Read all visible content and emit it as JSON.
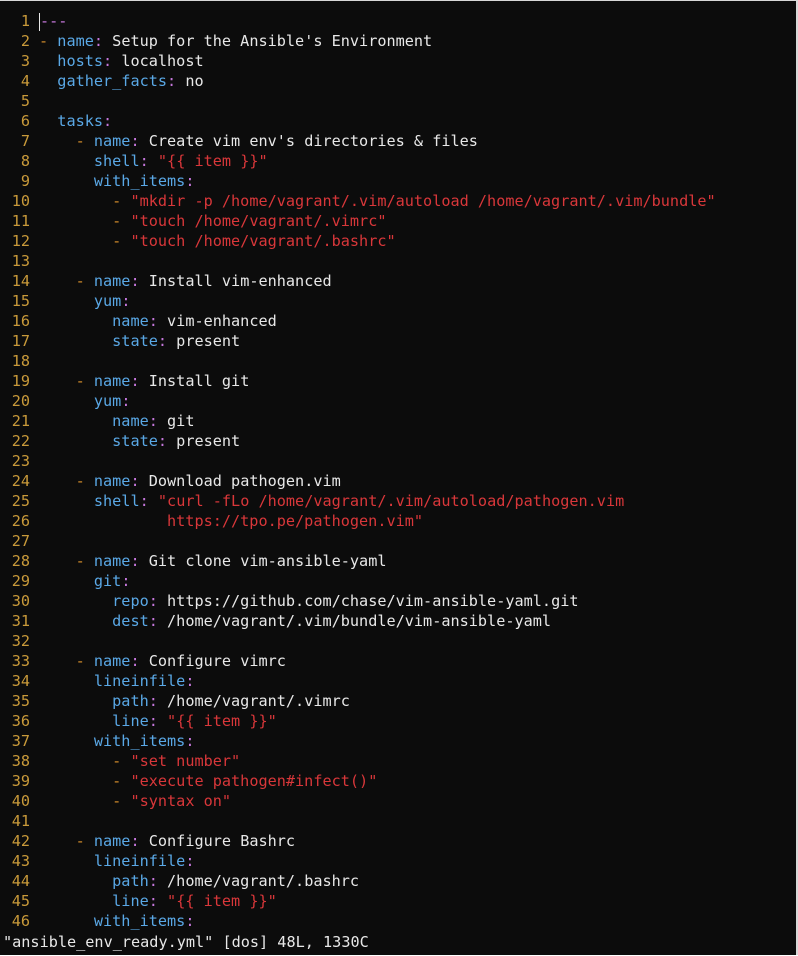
{
  "editor": {
    "lines": [
      {
        "num": "1",
        "tokens": [
          {
            "t": "doc",
            "v": "---"
          }
        ],
        "cursor": true
      },
      {
        "num": "2",
        "tokens": [
          {
            "t": "dash",
            "v": "- "
          },
          {
            "t": "key",
            "v": "name"
          },
          {
            "t": "colon",
            "v": ":"
          },
          {
            "t": "text",
            "v": " Setup for the Ansible's Environment"
          }
        ]
      },
      {
        "num": "3",
        "tokens": [
          {
            "t": "text",
            "v": "  "
          },
          {
            "t": "key",
            "v": "hosts"
          },
          {
            "t": "colon",
            "v": ":"
          },
          {
            "t": "text",
            "v": " localhost"
          }
        ]
      },
      {
        "num": "4",
        "tokens": [
          {
            "t": "text",
            "v": "  "
          },
          {
            "t": "key",
            "v": "gather_facts"
          },
          {
            "t": "colon",
            "v": ":"
          },
          {
            "t": "text",
            "v": " no"
          }
        ]
      },
      {
        "num": "5",
        "tokens": []
      },
      {
        "num": "6",
        "tokens": [
          {
            "t": "text",
            "v": "  "
          },
          {
            "t": "key",
            "v": "tasks"
          },
          {
            "t": "colon",
            "v": ":"
          }
        ]
      },
      {
        "num": "7",
        "tokens": [
          {
            "t": "text",
            "v": "    "
          },
          {
            "t": "dash",
            "v": "- "
          },
          {
            "t": "key",
            "v": "name"
          },
          {
            "t": "colon",
            "v": ":"
          },
          {
            "t": "text",
            "v": " Create vim env's directories & files"
          }
        ]
      },
      {
        "num": "8",
        "tokens": [
          {
            "t": "text",
            "v": "      "
          },
          {
            "t": "key",
            "v": "shell"
          },
          {
            "t": "colon",
            "v": ":"
          },
          {
            "t": "text",
            "v": " "
          },
          {
            "t": "str",
            "v": "\"{{ item }}\""
          }
        ]
      },
      {
        "num": "9",
        "tokens": [
          {
            "t": "text",
            "v": "      "
          },
          {
            "t": "key",
            "v": "with_items"
          },
          {
            "t": "colon",
            "v": ":"
          }
        ]
      },
      {
        "num": "10",
        "tokens": [
          {
            "t": "text",
            "v": "        "
          },
          {
            "t": "dash",
            "v": "- "
          },
          {
            "t": "str",
            "v": "\"mkdir -p /home/vagrant/.vim/autoload /home/vagrant/.vim/bundle\""
          }
        ]
      },
      {
        "num": "11",
        "tokens": [
          {
            "t": "text",
            "v": "        "
          },
          {
            "t": "dash",
            "v": "- "
          },
          {
            "t": "str",
            "v": "\"touch /home/vagrant/.vimrc\""
          }
        ]
      },
      {
        "num": "12",
        "tokens": [
          {
            "t": "text",
            "v": "        "
          },
          {
            "t": "dash",
            "v": "- "
          },
          {
            "t": "str",
            "v": "\"touch /home/vagrant/.bashrc\""
          }
        ]
      },
      {
        "num": "13",
        "tokens": []
      },
      {
        "num": "14",
        "tokens": [
          {
            "t": "text",
            "v": "    "
          },
          {
            "t": "dash",
            "v": "- "
          },
          {
            "t": "key",
            "v": "name"
          },
          {
            "t": "colon",
            "v": ":"
          },
          {
            "t": "text",
            "v": " Install vim-enhanced"
          }
        ]
      },
      {
        "num": "15",
        "tokens": [
          {
            "t": "text",
            "v": "      "
          },
          {
            "t": "key",
            "v": "yum"
          },
          {
            "t": "colon",
            "v": ":"
          }
        ]
      },
      {
        "num": "16",
        "tokens": [
          {
            "t": "text",
            "v": "        "
          },
          {
            "t": "key",
            "v": "name"
          },
          {
            "t": "colon",
            "v": ":"
          },
          {
            "t": "text",
            "v": " vim-enhanced"
          }
        ]
      },
      {
        "num": "17",
        "tokens": [
          {
            "t": "text",
            "v": "        "
          },
          {
            "t": "key",
            "v": "state"
          },
          {
            "t": "colon",
            "v": ":"
          },
          {
            "t": "text",
            "v": " present"
          }
        ]
      },
      {
        "num": "18",
        "tokens": []
      },
      {
        "num": "19",
        "tokens": [
          {
            "t": "text",
            "v": "    "
          },
          {
            "t": "dash",
            "v": "- "
          },
          {
            "t": "key",
            "v": "name"
          },
          {
            "t": "colon",
            "v": ":"
          },
          {
            "t": "text",
            "v": " Install git"
          }
        ]
      },
      {
        "num": "20",
        "tokens": [
          {
            "t": "text",
            "v": "      "
          },
          {
            "t": "key",
            "v": "yum"
          },
          {
            "t": "colon",
            "v": ":"
          }
        ]
      },
      {
        "num": "21",
        "tokens": [
          {
            "t": "text",
            "v": "        "
          },
          {
            "t": "key",
            "v": "name"
          },
          {
            "t": "colon",
            "v": ":"
          },
          {
            "t": "text",
            "v": " git"
          }
        ]
      },
      {
        "num": "22",
        "tokens": [
          {
            "t": "text",
            "v": "        "
          },
          {
            "t": "key",
            "v": "state"
          },
          {
            "t": "colon",
            "v": ":"
          },
          {
            "t": "text",
            "v": " present"
          }
        ]
      },
      {
        "num": "23",
        "tokens": []
      },
      {
        "num": "24",
        "tokens": [
          {
            "t": "text",
            "v": "    "
          },
          {
            "t": "dash",
            "v": "- "
          },
          {
            "t": "key",
            "v": "name"
          },
          {
            "t": "colon",
            "v": ":"
          },
          {
            "t": "text",
            "v": " Download pathogen.vim"
          }
        ]
      },
      {
        "num": "25",
        "tokens": [
          {
            "t": "text",
            "v": "      "
          },
          {
            "t": "key",
            "v": "shell"
          },
          {
            "t": "colon",
            "v": ":"
          },
          {
            "t": "text",
            "v": " "
          },
          {
            "t": "str",
            "v": "\"curl -fLo /home/vagrant/.vim/autoload/pathogen.vim"
          }
        ]
      },
      {
        "num": "26",
        "tokens": [
          {
            "t": "text",
            "v": "              "
          },
          {
            "t": "str",
            "v": "https://tpo.pe/pathogen.vim\""
          }
        ]
      },
      {
        "num": "27",
        "tokens": []
      },
      {
        "num": "28",
        "tokens": [
          {
            "t": "text",
            "v": "    "
          },
          {
            "t": "dash",
            "v": "- "
          },
          {
            "t": "key",
            "v": "name"
          },
          {
            "t": "colon",
            "v": ":"
          },
          {
            "t": "text",
            "v": " Git clone vim-ansible-yaml"
          }
        ]
      },
      {
        "num": "29",
        "tokens": [
          {
            "t": "text",
            "v": "      "
          },
          {
            "t": "key",
            "v": "git"
          },
          {
            "t": "colon",
            "v": ":"
          }
        ]
      },
      {
        "num": "30",
        "tokens": [
          {
            "t": "text",
            "v": "        "
          },
          {
            "t": "key",
            "v": "repo"
          },
          {
            "t": "colon",
            "v": ":"
          },
          {
            "t": "text",
            "v": " https://github.com/chase/vim-ansible-yaml.git"
          }
        ]
      },
      {
        "num": "31",
        "tokens": [
          {
            "t": "text",
            "v": "        "
          },
          {
            "t": "key",
            "v": "dest"
          },
          {
            "t": "colon",
            "v": ":"
          },
          {
            "t": "text",
            "v": " /home/vagrant/.vim/bundle/vim-ansible-yaml"
          }
        ]
      },
      {
        "num": "32",
        "tokens": []
      },
      {
        "num": "33",
        "tokens": [
          {
            "t": "text",
            "v": "    "
          },
          {
            "t": "dash",
            "v": "- "
          },
          {
            "t": "key",
            "v": "name"
          },
          {
            "t": "colon",
            "v": ":"
          },
          {
            "t": "text",
            "v": " Configure vimrc"
          }
        ]
      },
      {
        "num": "34",
        "tokens": [
          {
            "t": "text",
            "v": "      "
          },
          {
            "t": "key",
            "v": "lineinfile"
          },
          {
            "t": "colon",
            "v": ":"
          }
        ]
      },
      {
        "num": "35",
        "tokens": [
          {
            "t": "text",
            "v": "        "
          },
          {
            "t": "key",
            "v": "path"
          },
          {
            "t": "colon",
            "v": ":"
          },
          {
            "t": "text",
            "v": " /home/vagrant/.vimrc"
          }
        ]
      },
      {
        "num": "36",
        "tokens": [
          {
            "t": "text",
            "v": "        "
          },
          {
            "t": "key",
            "v": "line"
          },
          {
            "t": "colon",
            "v": ":"
          },
          {
            "t": "text",
            "v": " "
          },
          {
            "t": "str",
            "v": "\"{{ item }}\""
          }
        ]
      },
      {
        "num": "37",
        "tokens": [
          {
            "t": "text",
            "v": "      "
          },
          {
            "t": "key",
            "v": "with_items"
          },
          {
            "t": "colon",
            "v": ":"
          }
        ]
      },
      {
        "num": "38",
        "tokens": [
          {
            "t": "text",
            "v": "        "
          },
          {
            "t": "dash",
            "v": "- "
          },
          {
            "t": "str",
            "v": "\"set number\""
          }
        ]
      },
      {
        "num": "39",
        "tokens": [
          {
            "t": "text",
            "v": "        "
          },
          {
            "t": "dash",
            "v": "- "
          },
          {
            "t": "str",
            "v": "\"execute pathogen#infect()\""
          }
        ]
      },
      {
        "num": "40",
        "tokens": [
          {
            "t": "text",
            "v": "        "
          },
          {
            "t": "dash",
            "v": "- "
          },
          {
            "t": "str",
            "v": "\"syntax on\""
          }
        ]
      },
      {
        "num": "41",
        "tokens": []
      },
      {
        "num": "42",
        "tokens": [
          {
            "t": "text",
            "v": "    "
          },
          {
            "t": "dash",
            "v": "- "
          },
          {
            "t": "key",
            "v": "name"
          },
          {
            "t": "colon",
            "v": ":"
          },
          {
            "t": "text",
            "v": " Configure Bashrc"
          }
        ]
      },
      {
        "num": "43",
        "tokens": [
          {
            "t": "text",
            "v": "      "
          },
          {
            "t": "key",
            "v": "lineinfile"
          },
          {
            "t": "colon",
            "v": ":"
          }
        ]
      },
      {
        "num": "44",
        "tokens": [
          {
            "t": "text",
            "v": "        "
          },
          {
            "t": "key",
            "v": "path"
          },
          {
            "t": "colon",
            "v": ":"
          },
          {
            "t": "text",
            "v": " /home/vagrant/.bashrc"
          }
        ]
      },
      {
        "num": "45",
        "tokens": [
          {
            "t": "text",
            "v": "        "
          },
          {
            "t": "key",
            "v": "line"
          },
          {
            "t": "colon",
            "v": ":"
          },
          {
            "t": "text",
            "v": " "
          },
          {
            "t": "str",
            "v": "\"{{ item }}\""
          }
        ]
      },
      {
        "num": "46",
        "tokens": [
          {
            "t": "text",
            "v": "      "
          },
          {
            "t": "key",
            "v": "with_items"
          },
          {
            "t": "colon",
            "v": ":"
          }
        ]
      }
    ]
  },
  "status": {
    "message": "\"ansible_env_ready.yml\" [dos] 48L, 1330C"
  },
  "colors": {
    "background": "#0c0c0c",
    "line_number": "#c99a3a",
    "key": "#5aa8e6",
    "colon": "#c678dd",
    "string": "#d9373a",
    "dash": "#cf8a2a",
    "text": "#e8e8e8"
  }
}
